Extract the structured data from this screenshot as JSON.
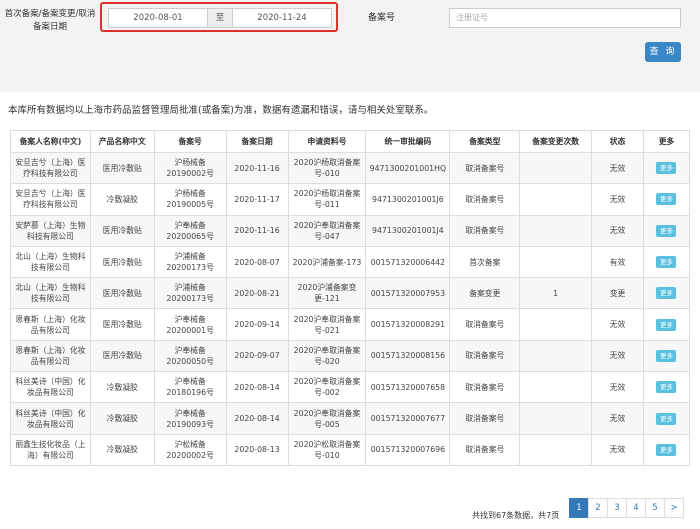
{
  "filters": {
    "date_label": "首次备案/备案变更/取消备案日期",
    "date_start": "2020-08-01",
    "date_sep": "至",
    "date_end": "2020-11-24",
    "reg_label": "备案号",
    "reg_placeholder": "注册证号",
    "search_button": "查 询"
  },
  "notice": "本库所有数据均以上海市药品监督管理局批准(或备案)为准，数据有遗漏和错误，请与相关处室联系。",
  "table": {
    "headers": [
      "备案人名称(中文)",
      "产品名称中文",
      "备案号",
      "备案日期",
      "申请资料号",
      "统一审批编码",
      "备案类型",
      "备案变更次数",
      "状态",
      "更多"
    ],
    "rows": [
      [
        "安旦吉兮（上海）医疗科技有限公司",
        "医用冷敷贴",
        "沪杨械备20190002号",
        "2020-11-16",
        "2020沪杨取消备案号-010",
        "9471300201001HQ",
        "取消备案号",
        "",
        "无效",
        "更多"
      ],
      [
        "安旦吉兮（上海）医疗科技有限公司",
        "冷敷凝胶",
        "沪杨械备20190005号",
        "2020-11-17",
        "2020沪杨取消备案号-011",
        "9471300201001J6",
        "取消备案号",
        "",
        "无效",
        "更多"
      ],
      [
        "安萨慕（上海）生物科技有限公司",
        "医用冷敷贴",
        "沪奉械备20200065号",
        "2020-11-16",
        "2020沪奉取消备案号-047",
        "9471300201001J4",
        "取消备案号",
        "",
        "无效",
        "更多"
      ],
      [
        "北山（上海）生物科技有限公司",
        "医用冷敷贴",
        "沪浦械备20200173号",
        "2020-08-07",
        "2020沪浦备案-173",
        "001571320006442",
        "首次备案",
        "",
        "有效",
        "更多"
      ],
      [
        "北山（上海）生物科技有限公司",
        "医用冷敷贴",
        "沪浦械备20200173号",
        "2020-08-21",
        "2020沪浦备案变更-121",
        "001571320007953",
        "备案变更",
        "1",
        "变更",
        "更多"
      ],
      [
        "恩春斯（上海）化妆品有限公司",
        "医用冷敷贴",
        "沪奉械备20200001号",
        "2020-09-14",
        "2020沪奉取消备案号-021",
        "001571320008291",
        "取消备案号",
        "",
        "无效",
        "更多"
      ],
      [
        "恩春斯（上海）化妆品有限公司",
        "医用冷敷贴",
        "沪奉械备20200050号",
        "2020-09-07",
        "2020沪奉取消备案号-020",
        "001571320008156",
        "取消备案号",
        "",
        "无效",
        "更多"
      ],
      [
        "科丝美诗（中国）化妆品有限公司",
        "冷敷凝胶",
        "沪奉械备20180196号",
        "2020-08-14",
        "2020沪奉取消备案号-002",
        "001571320007658",
        "取消备案号",
        "",
        "无效",
        "更多"
      ],
      [
        "科丝美诗（中国）化妆品有限公司",
        "冷敷凝胶",
        "沪奉械备20190093号",
        "2020-08-14",
        "2020沪奉取消备案号-005",
        "001571320007677",
        "取消备案号",
        "",
        "无效",
        "更多"
      ],
      [
        "丽鑫生技化妆品（上海）有限公司",
        "冷敷凝胶",
        "沪松械备20200002号",
        "2020-08-13",
        "2020沪松取消备案号-010",
        "001571320007696",
        "取消备案号",
        "",
        "无效",
        "更多"
      ]
    ]
  },
  "pagination": {
    "summary": "共找到67条数据，共7页",
    "pages": [
      "1",
      "2",
      "3",
      "4",
      "5",
      ">"
    ],
    "active": "1"
  }
}
